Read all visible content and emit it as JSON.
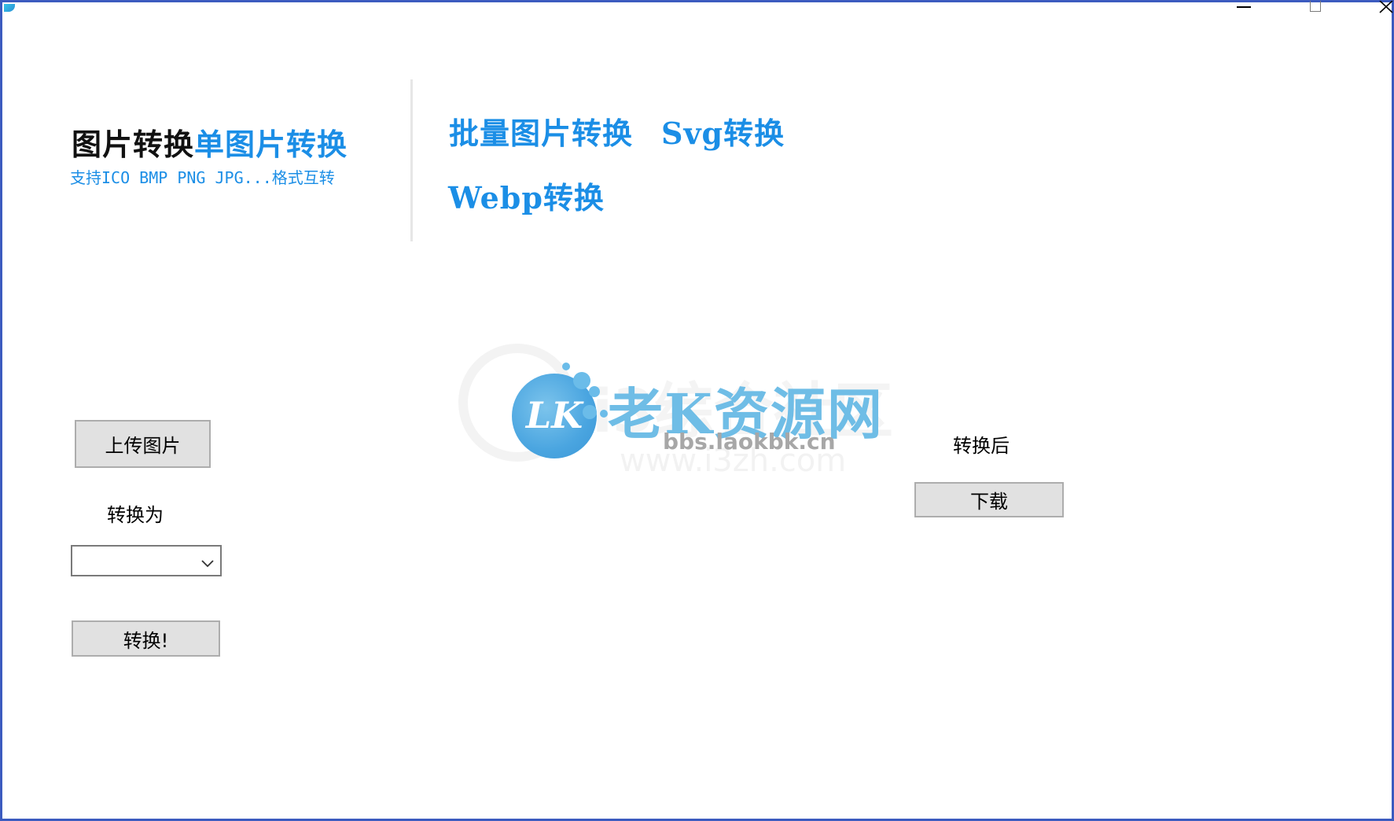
{
  "window": {
    "controls": {
      "minimize_icon": "minimize-icon",
      "maximize_icon": "maximize-icon",
      "close_icon": "close-icon"
    },
    "border_color": "#3c5bbf"
  },
  "header": {
    "title": "图片转换",
    "title_link": "单图片转换",
    "subtitle": "支持ICO BMP PNG JPG...格式互转",
    "nav": {
      "batch": "批量图片转换",
      "svg": "Svg转换",
      "webp": "Webp转换"
    },
    "accent_color": "#1b8ee6"
  },
  "watermark": {
    "logo_text": "LK",
    "brand": "老K资源网",
    "url": "bbs.laokbk.cn",
    "ghost_text": "i3综合社区",
    "ghost_url": "www.i3zh.com"
  },
  "left_panel": {
    "upload_button": "上传图片",
    "convert_to_label": "转换为",
    "format_select": {
      "value": "",
      "chevron_icon": "chevron-down-icon"
    },
    "convert_button": "转换!"
  },
  "right_panel": {
    "after_label": "转换后",
    "download_button": "下载"
  }
}
